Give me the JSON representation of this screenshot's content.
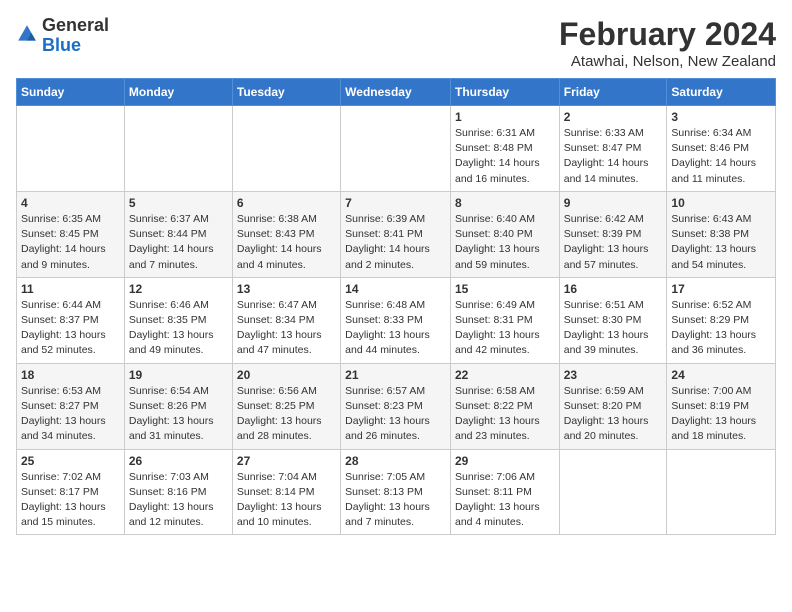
{
  "header": {
    "logo": {
      "general": "General",
      "blue": "Blue"
    },
    "title": "February 2024",
    "location": "Atawhai, Nelson, New Zealand"
  },
  "days_of_week": [
    "Sunday",
    "Monday",
    "Tuesday",
    "Wednesday",
    "Thursday",
    "Friday",
    "Saturday"
  ],
  "weeks": [
    [
      {
        "day": "",
        "info": ""
      },
      {
        "day": "",
        "info": ""
      },
      {
        "day": "",
        "info": ""
      },
      {
        "day": "",
        "info": ""
      },
      {
        "day": "1",
        "info": "Sunrise: 6:31 AM\nSunset: 8:48 PM\nDaylight: 14 hours\nand 16 minutes."
      },
      {
        "day": "2",
        "info": "Sunrise: 6:33 AM\nSunset: 8:47 PM\nDaylight: 14 hours\nand 14 minutes."
      },
      {
        "day": "3",
        "info": "Sunrise: 6:34 AM\nSunset: 8:46 PM\nDaylight: 14 hours\nand 11 minutes."
      }
    ],
    [
      {
        "day": "4",
        "info": "Sunrise: 6:35 AM\nSunset: 8:45 PM\nDaylight: 14 hours\nand 9 minutes."
      },
      {
        "day": "5",
        "info": "Sunrise: 6:37 AM\nSunset: 8:44 PM\nDaylight: 14 hours\nand 7 minutes."
      },
      {
        "day": "6",
        "info": "Sunrise: 6:38 AM\nSunset: 8:43 PM\nDaylight: 14 hours\nand 4 minutes."
      },
      {
        "day": "7",
        "info": "Sunrise: 6:39 AM\nSunset: 8:41 PM\nDaylight: 14 hours\nand 2 minutes."
      },
      {
        "day": "8",
        "info": "Sunrise: 6:40 AM\nSunset: 8:40 PM\nDaylight: 13 hours\nand 59 minutes."
      },
      {
        "day": "9",
        "info": "Sunrise: 6:42 AM\nSunset: 8:39 PM\nDaylight: 13 hours\nand 57 minutes."
      },
      {
        "day": "10",
        "info": "Sunrise: 6:43 AM\nSunset: 8:38 PM\nDaylight: 13 hours\nand 54 minutes."
      }
    ],
    [
      {
        "day": "11",
        "info": "Sunrise: 6:44 AM\nSunset: 8:37 PM\nDaylight: 13 hours\nand 52 minutes."
      },
      {
        "day": "12",
        "info": "Sunrise: 6:46 AM\nSunset: 8:35 PM\nDaylight: 13 hours\nand 49 minutes."
      },
      {
        "day": "13",
        "info": "Sunrise: 6:47 AM\nSunset: 8:34 PM\nDaylight: 13 hours\nand 47 minutes."
      },
      {
        "day": "14",
        "info": "Sunrise: 6:48 AM\nSunset: 8:33 PM\nDaylight: 13 hours\nand 44 minutes."
      },
      {
        "day": "15",
        "info": "Sunrise: 6:49 AM\nSunset: 8:31 PM\nDaylight: 13 hours\nand 42 minutes."
      },
      {
        "day": "16",
        "info": "Sunrise: 6:51 AM\nSunset: 8:30 PM\nDaylight: 13 hours\nand 39 minutes."
      },
      {
        "day": "17",
        "info": "Sunrise: 6:52 AM\nSunset: 8:29 PM\nDaylight: 13 hours\nand 36 minutes."
      }
    ],
    [
      {
        "day": "18",
        "info": "Sunrise: 6:53 AM\nSunset: 8:27 PM\nDaylight: 13 hours\nand 34 minutes."
      },
      {
        "day": "19",
        "info": "Sunrise: 6:54 AM\nSunset: 8:26 PM\nDaylight: 13 hours\nand 31 minutes."
      },
      {
        "day": "20",
        "info": "Sunrise: 6:56 AM\nSunset: 8:25 PM\nDaylight: 13 hours\nand 28 minutes."
      },
      {
        "day": "21",
        "info": "Sunrise: 6:57 AM\nSunset: 8:23 PM\nDaylight: 13 hours\nand 26 minutes."
      },
      {
        "day": "22",
        "info": "Sunrise: 6:58 AM\nSunset: 8:22 PM\nDaylight: 13 hours\nand 23 minutes."
      },
      {
        "day": "23",
        "info": "Sunrise: 6:59 AM\nSunset: 8:20 PM\nDaylight: 13 hours\nand 20 minutes."
      },
      {
        "day": "24",
        "info": "Sunrise: 7:00 AM\nSunset: 8:19 PM\nDaylight: 13 hours\nand 18 minutes."
      }
    ],
    [
      {
        "day": "25",
        "info": "Sunrise: 7:02 AM\nSunset: 8:17 PM\nDaylight: 13 hours\nand 15 minutes."
      },
      {
        "day": "26",
        "info": "Sunrise: 7:03 AM\nSunset: 8:16 PM\nDaylight: 13 hours\nand 12 minutes."
      },
      {
        "day": "27",
        "info": "Sunrise: 7:04 AM\nSunset: 8:14 PM\nDaylight: 13 hours\nand 10 minutes."
      },
      {
        "day": "28",
        "info": "Sunrise: 7:05 AM\nSunset: 8:13 PM\nDaylight: 13 hours\nand 7 minutes."
      },
      {
        "day": "29",
        "info": "Sunrise: 7:06 AM\nSunset: 8:11 PM\nDaylight: 13 hours\nand 4 minutes."
      },
      {
        "day": "",
        "info": ""
      },
      {
        "day": "",
        "info": ""
      }
    ]
  ]
}
